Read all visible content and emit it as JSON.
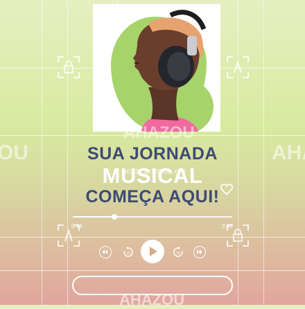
{
  "headline": {
    "line1": "SUA JORNADA",
    "line2": "MUSICAL",
    "line3": "COMEÇA AQUI!"
  },
  "player": {
    "elapsed": "0:44",
    "duration": "3:45",
    "progress": 0.26
  },
  "watermarks": {
    "brand": "ahazou",
    "brand_caps": "AHAZOU",
    "center_brand": "AHAZOU",
    "url": "posts.prontos.em",
    "left_mark": "OU",
    "right_mark": "AHA"
  },
  "colors": {
    "headline_dark": "#3e4a73",
    "headline_light": "#ffffff",
    "accent_green": "#a6d36a",
    "gradient_top": "#e6efc1",
    "gradient_bottom": "#e2a59e"
  },
  "icons": {
    "favorite": "heart-icon",
    "rewind": "rewind-icon",
    "replay": "replay-10-icon",
    "play": "play-icon",
    "forward": "forward-10-icon",
    "fast_forward": "fast-forward-icon"
  }
}
